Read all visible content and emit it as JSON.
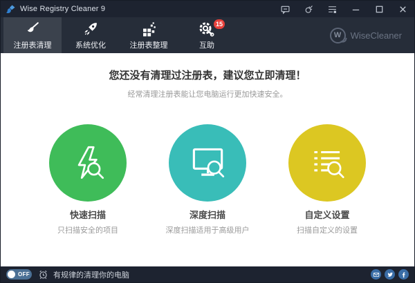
{
  "window": {
    "title": "Wise Registry Cleaner 9"
  },
  "nav": {
    "tabs": [
      {
        "label": "注册表清理",
        "icon": "brush-icon",
        "active": true
      },
      {
        "label": "系统优化",
        "icon": "rocket-icon",
        "active": false
      },
      {
        "label": "注册表整理",
        "icon": "defrag-blocks-icon",
        "active": false
      },
      {
        "label": "互助",
        "icon": "gear-wrench-icon",
        "active": false,
        "badge": "15"
      }
    ],
    "brand": {
      "initial": "W",
      "name": "WiseCleaner"
    }
  },
  "main": {
    "heading": "您还没有清理过注册表，建议您立即清理！",
    "subheading": "经常清理注册表能让您电脑运行更加快速安全。",
    "actions": [
      {
        "label": "快速扫描",
        "description": "只扫描安全的项目",
        "color": "#3fbc59",
        "icon": "lightning-scan-icon"
      },
      {
        "label": "深度扫描",
        "description": "深度扫描适用于高级用户",
        "color": "#39bdb8",
        "icon": "monitor-scan-icon"
      },
      {
        "label": "自定义设置",
        "description": "扫描自定义的设置",
        "color": "#dcc722",
        "icon": "list-scan-icon"
      }
    ]
  },
  "statusbar": {
    "toggle_state": "OFF",
    "message": "有规律的清理你的电脑"
  },
  "colors": {
    "titlebar_bg": "#1d2330",
    "navbar_bg": "#262d39",
    "active_tab_bg": "#3b424d",
    "badge_red": "#e8413c",
    "quick_scan_green": "#3fbc59",
    "deep_scan_teal": "#39bdb8",
    "custom_yellow": "#dcc722",
    "toggle_blue": "#4b7095",
    "social_blue": "#3a6da6"
  }
}
